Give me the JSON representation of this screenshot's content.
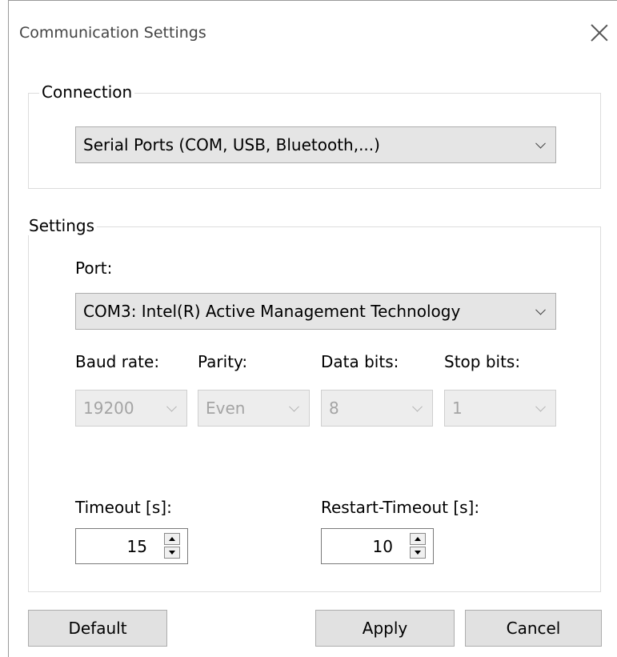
{
  "window": {
    "title": "Communication Settings",
    "close_icon": "close-icon"
  },
  "connection": {
    "group_label": "Connection",
    "type_value": "Serial Ports (COM, USB, Bluetooth,...)"
  },
  "settings": {
    "group_label": "Settings",
    "port_label": "Port:",
    "port_value": "COM3: Intel(R) Active Management Technology",
    "baud_label": "Baud rate:",
    "baud_value": "19200",
    "parity_label": "Parity:",
    "parity_value": "Even",
    "databits_label": "Data bits:",
    "databits_value": "8",
    "stopbits_label": "Stop bits:",
    "stopbits_value": "1",
    "timeout_label": "Timeout [s]:",
    "timeout_value": "15",
    "restart_timeout_label": "Restart-Timeout [s]:",
    "restart_timeout_value": "10"
  },
  "buttons": {
    "default_label": "Default",
    "apply_label": "Apply",
    "cancel_label": "Cancel"
  }
}
